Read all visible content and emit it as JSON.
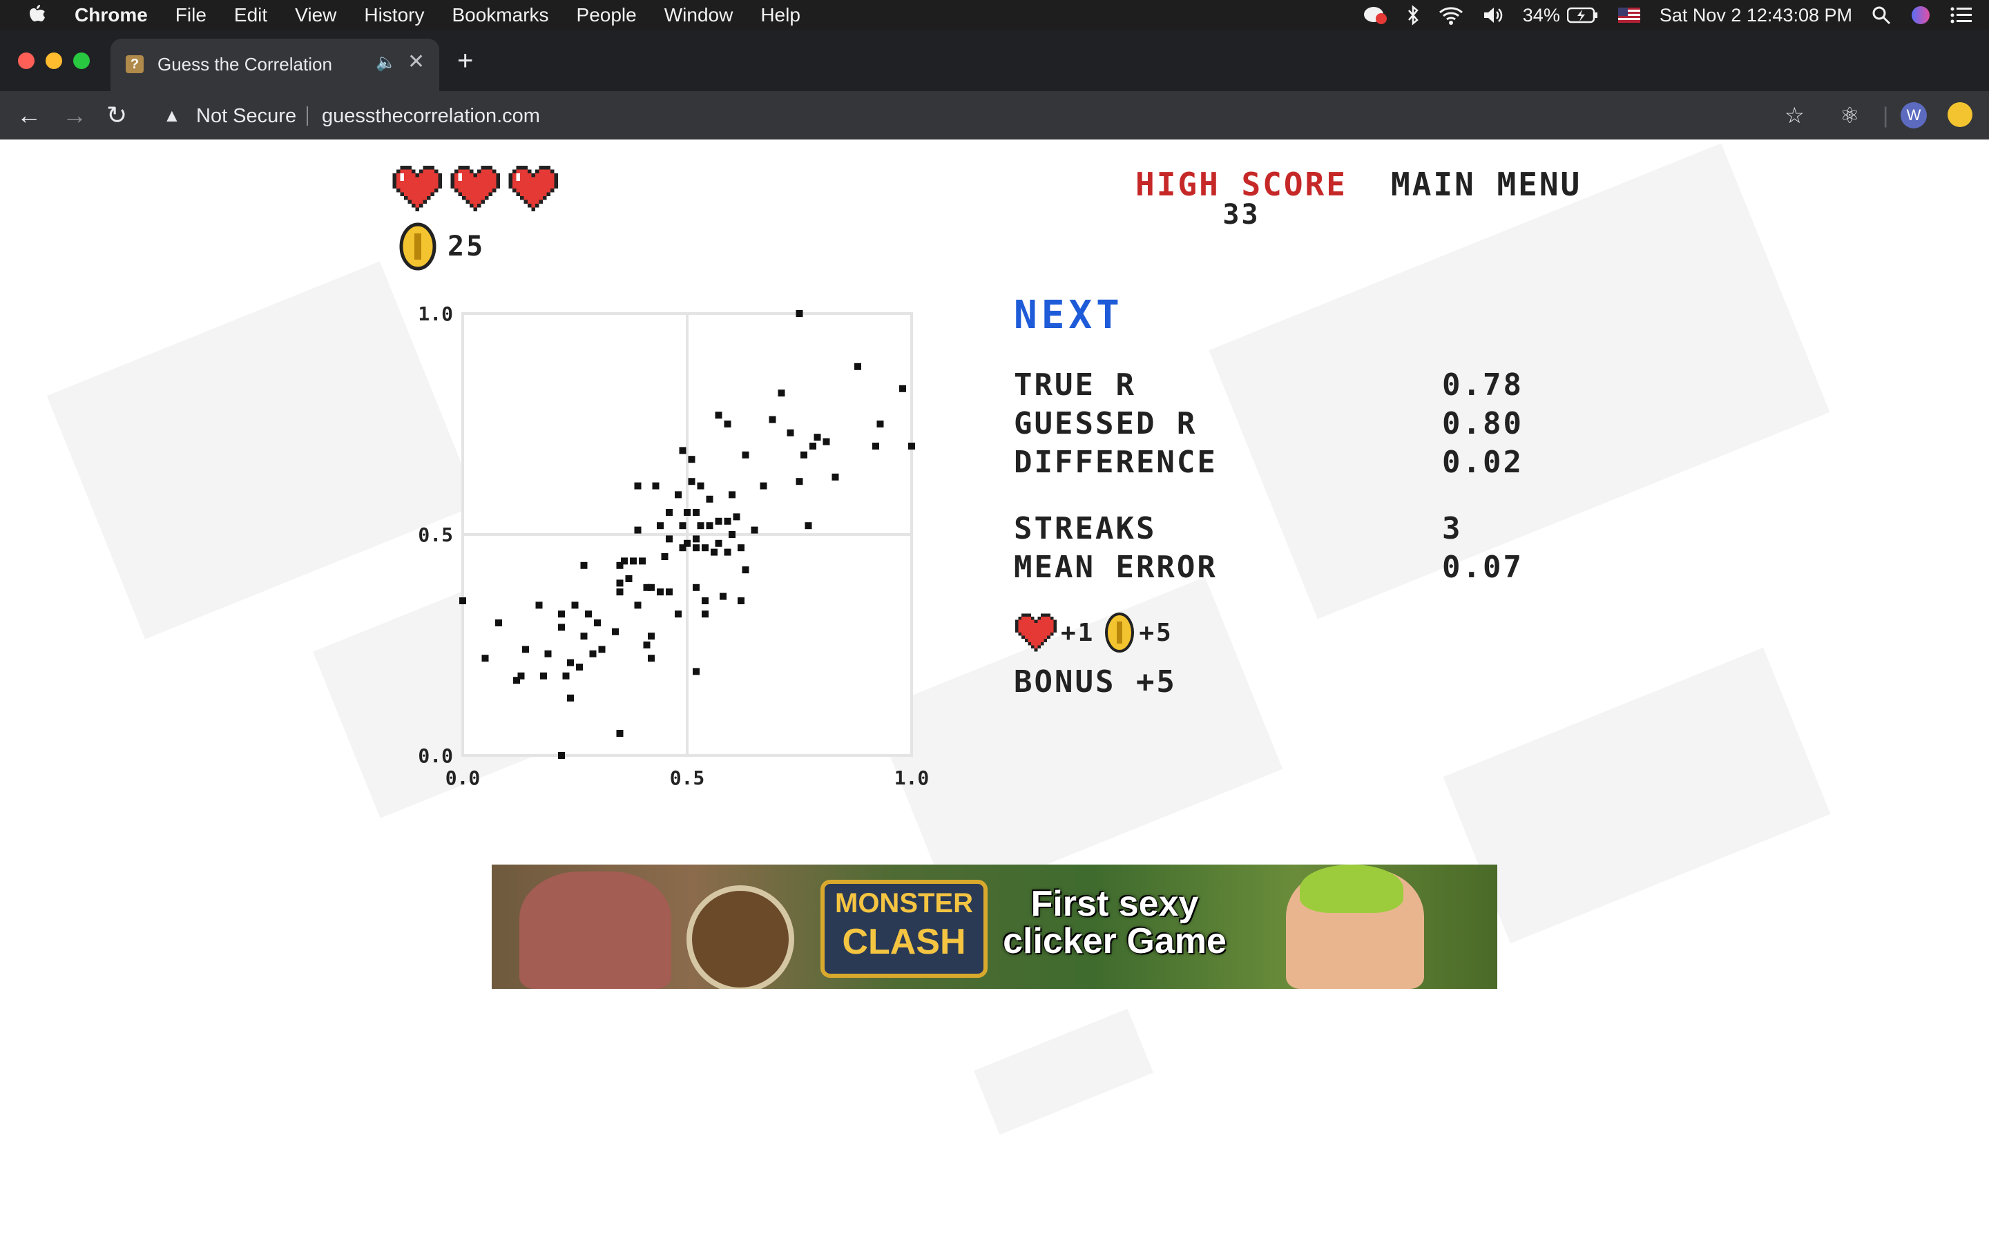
{
  "menubar": {
    "app_name": "Chrome",
    "menus": [
      "File",
      "Edit",
      "View",
      "History",
      "Bookmarks",
      "People",
      "Window",
      "Help"
    ],
    "battery": "34%",
    "datetime": "Sat Nov 2  12:43:08 PM"
  },
  "browser": {
    "tab_title": "Guess the Correlation",
    "security_label": "Not Secure",
    "url": "guessthecorrelation.com",
    "profile_initial": "W"
  },
  "game": {
    "lives": 3,
    "coins": "25",
    "high_score_label": "HIGH SCORE",
    "high_score": "33",
    "main_menu": "MAIN MENU",
    "next_label": "NEXT",
    "true_r_label": "TRUE R",
    "true_r": "0.78",
    "guessed_r_label": "GUESSED R",
    "guessed_r": "0.80",
    "difference_label": "DIFFERENCE",
    "difference": "0.02",
    "streaks_label": "STREAKS",
    "streaks": "3",
    "mean_error_label": "MEAN ERROR",
    "mean_error": "0.07",
    "reward_lives": "+1",
    "reward_coins": "+5",
    "bonus": "BONUS +5"
  },
  "ad": {
    "logo_line1": "MONSTER",
    "logo_line2": "CLASH",
    "tagline": "First sexy clicker Game"
  },
  "chart_data": {
    "type": "scatter",
    "xlim": [
      0,
      1
    ],
    "ylim": [
      0,
      1
    ],
    "x_ticks": [
      "0.0",
      "0.5",
      "1.0"
    ],
    "y_ticks": [
      "0.0",
      "0.5",
      "1.0"
    ],
    "grid": true,
    "points": [
      [
        0.75,
        1.0
      ],
      [
        0.88,
        0.88
      ],
      [
        0.98,
        0.83
      ],
      [
        0.71,
        0.82
      ],
      [
        0.57,
        0.77
      ],
      [
        0.59,
        0.75
      ],
      [
        0.69,
        0.76
      ],
      [
        0.93,
        0.75
      ],
      [
        0.73,
        0.73
      ],
      [
        0.79,
        0.72
      ],
      [
        0.81,
        0.71
      ],
      [
        0.78,
        0.7
      ],
      [
        0.92,
        0.7
      ],
      [
        1.0,
        0.7
      ],
      [
        0.49,
        0.69
      ],
      [
        0.63,
        0.68
      ],
      [
        0.76,
        0.68
      ],
      [
        0.51,
        0.67
      ],
      [
        0.83,
        0.63
      ],
      [
        0.75,
        0.62
      ],
      [
        0.51,
        0.62
      ],
      [
        0.53,
        0.61
      ],
      [
        0.39,
        0.61
      ],
      [
        0.43,
        0.61
      ],
      [
        0.67,
        0.61
      ],
      [
        0.48,
        0.59
      ],
      [
        0.6,
        0.59
      ],
      [
        0.55,
        0.58
      ],
      [
        0.46,
        0.55
      ],
      [
        0.5,
        0.55
      ],
      [
        0.52,
        0.55
      ],
      [
        0.61,
        0.54
      ],
      [
        0.57,
        0.53
      ],
      [
        0.59,
        0.53
      ],
      [
        0.49,
        0.52
      ],
      [
        0.53,
        0.52
      ],
      [
        0.55,
        0.52
      ],
      [
        0.44,
        0.52
      ],
      [
        0.39,
        0.51
      ],
      [
        0.77,
        0.52
      ],
      [
        0.65,
        0.51
      ],
      [
        0.6,
        0.5
      ],
      [
        0.52,
        0.49
      ],
      [
        0.46,
        0.49
      ],
      [
        0.5,
        0.48
      ],
      [
        0.57,
        0.48
      ],
      [
        0.49,
        0.47
      ],
      [
        0.62,
        0.47
      ],
      [
        0.52,
        0.47
      ],
      [
        0.54,
        0.47
      ],
      [
        0.59,
        0.46
      ],
      [
        0.56,
        0.46
      ],
      [
        0.45,
        0.45
      ],
      [
        0.38,
        0.44
      ],
      [
        0.4,
        0.44
      ],
      [
        0.36,
        0.44
      ],
      [
        0.27,
        0.43
      ],
      [
        0.63,
        0.42
      ],
      [
        0.35,
        0.43
      ],
      [
        0.37,
        0.4
      ],
      [
        0.35,
        0.39
      ],
      [
        0.41,
        0.38
      ],
      [
        0.42,
        0.38
      ],
      [
        0.35,
        0.37
      ],
      [
        0.52,
        0.38
      ],
      [
        0.44,
        0.37
      ],
      [
        0.46,
        0.37
      ],
      [
        0.58,
        0.36
      ],
      [
        0.54,
        0.35
      ],
      [
        0.62,
        0.35
      ],
      [
        0.0,
        0.35
      ],
      [
        0.17,
        0.34
      ],
      [
        0.25,
        0.34
      ],
      [
        0.39,
        0.34
      ],
      [
        0.28,
        0.32
      ],
      [
        0.22,
        0.32
      ],
      [
        0.48,
        0.32
      ],
      [
        0.54,
        0.32
      ],
      [
        0.3,
        0.3
      ],
      [
        0.22,
        0.29
      ],
      [
        0.08,
        0.3
      ],
      [
        0.34,
        0.28
      ],
      [
        0.42,
        0.27
      ],
      [
        0.27,
        0.27
      ],
      [
        0.31,
        0.24
      ],
      [
        0.29,
        0.23
      ],
      [
        0.14,
        0.24
      ],
      [
        0.19,
        0.23
      ],
      [
        0.41,
        0.25
      ],
      [
        0.42,
        0.22
      ],
      [
        0.05,
        0.22
      ],
      [
        0.24,
        0.21
      ],
      [
        0.26,
        0.2
      ],
      [
        0.13,
        0.18
      ],
      [
        0.18,
        0.18
      ],
      [
        0.12,
        0.17
      ],
      [
        0.23,
        0.18
      ],
      [
        0.52,
        0.19
      ],
      [
        0.24,
        0.13
      ],
      [
        0.35,
        0.05
      ],
      [
        0.22,
        0.0
      ]
    ]
  }
}
